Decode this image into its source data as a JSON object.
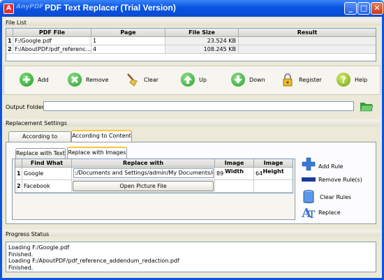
{
  "window": {
    "brand": "AnyPDF",
    "title": "PDF Text Replacer (Trial Version)",
    "minimize": "_",
    "maximize": "□",
    "close": "✕"
  },
  "file_list": {
    "label": "File List",
    "columns": [
      "PDF File",
      "Page",
      "File Size",
      "Result"
    ],
    "rows": [
      {
        "index": "1",
        "file": "F:/Google.pdf",
        "page": "1",
        "size": "23.524 KB",
        "result": ""
      },
      {
        "index": "2",
        "file": "F:/AboutPDF/pdf_referenc...",
        "page": "4",
        "size": "108.245 KB",
        "result": ""
      }
    ]
  },
  "toolbar": {
    "add": "Add",
    "remove": "Remove",
    "clear": "Clear",
    "up": "Up",
    "down": "Down",
    "register": "Register",
    "help": "Help"
  },
  "output_folder": {
    "label": "Output Folder",
    "value": ""
  },
  "replacement": {
    "label": "Replacement Settings",
    "tabs": [
      "According to Positions",
      "According to Content"
    ],
    "subtabs": [
      "Replace with Text",
      "Replace with Images"
    ],
    "columns": [
      "Find What",
      "Replace with",
      "Image Width",
      "Image Height"
    ],
    "rows": [
      {
        "index": "1",
        "find": "Google",
        "replace": ":/Documents and Settings/admin/My Documents/google.jp",
        "width": "89",
        "height": "64"
      },
      {
        "index": "2",
        "find": "Facebook",
        "replace": "Open Picture File",
        "width": "",
        "height": ""
      }
    ],
    "actions": {
      "add_rule": "Add Rule",
      "remove_rule": "Remove Rule(s)",
      "clear_rules": "Clear Rules",
      "replace": "Replace"
    }
  },
  "progress": {
    "label": "Progress Status",
    "lines": [
      "Loading F:/Google.pdf",
      "Finished.",
      "Loading F:/AboutPDF/pdf_reference_addendum_redaction.pdf",
      "Finished."
    ]
  }
}
